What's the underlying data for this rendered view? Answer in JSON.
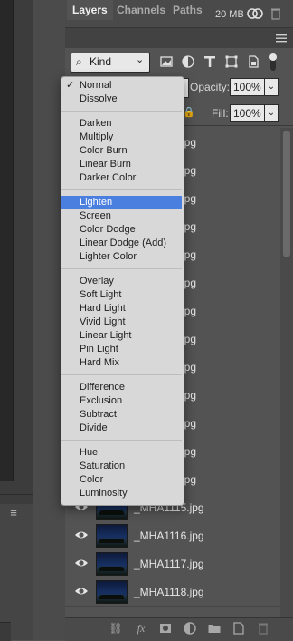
{
  "topbar": {
    "memory_label": "20 MB"
  },
  "tabs": [
    "Layers",
    "Channels",
    "Paths"
  ],
  "filter": {
    "kind_label": "Kind"
  },
  "layer_controls": {
    "opacity_label": "Opacity:",
    "opacity_value": "100%",
    "fill_label": "Fill:",
    "fill_value": "100%"
  },
  "blend_menu": {
    "selected": "Lighten",
    "checked": "Normal",
    "groups": [
      [
        "Normal",
        "Dissolve"
      ],
      [
        "Darken",
        "Multiply",
        "Color Burn",
        "Linear Burn",
        "Darker Color"
      ],
      [
        "Lighten",
        "Screen",
        "Color Dodge",
        "Linear Dodge (Add)",
        "Lighter Color"
      ],
      [
        "Overlay",
        "Soft Light",
        "Hard Light",
        "Vivid Light",
        "Linear Light",
        "Pin Light",
        "Hard Mix"
      ],
      [
        "Difference",
        "Exclusion",
        "Subtract",
        "Divide"
      ],
      [
        "Hue",
        "Saturation",
        "Color",
        "Luminosity"
      ]
    ]
  },
  "layers": {
    "partial_suffix": "jpg",
    "visible_rows": [
      "_MHA1115.jpg",
      "_MHA1116.jpg",
      "_MHA1117.jpg",
      "_MHA1118.jpg"
    ]
  },
  "colors": {
    "selection": "#4a7fe0",
    "panel_bg": "#535353",
    "menu_bg": "#d8d8d8"
  }
}
